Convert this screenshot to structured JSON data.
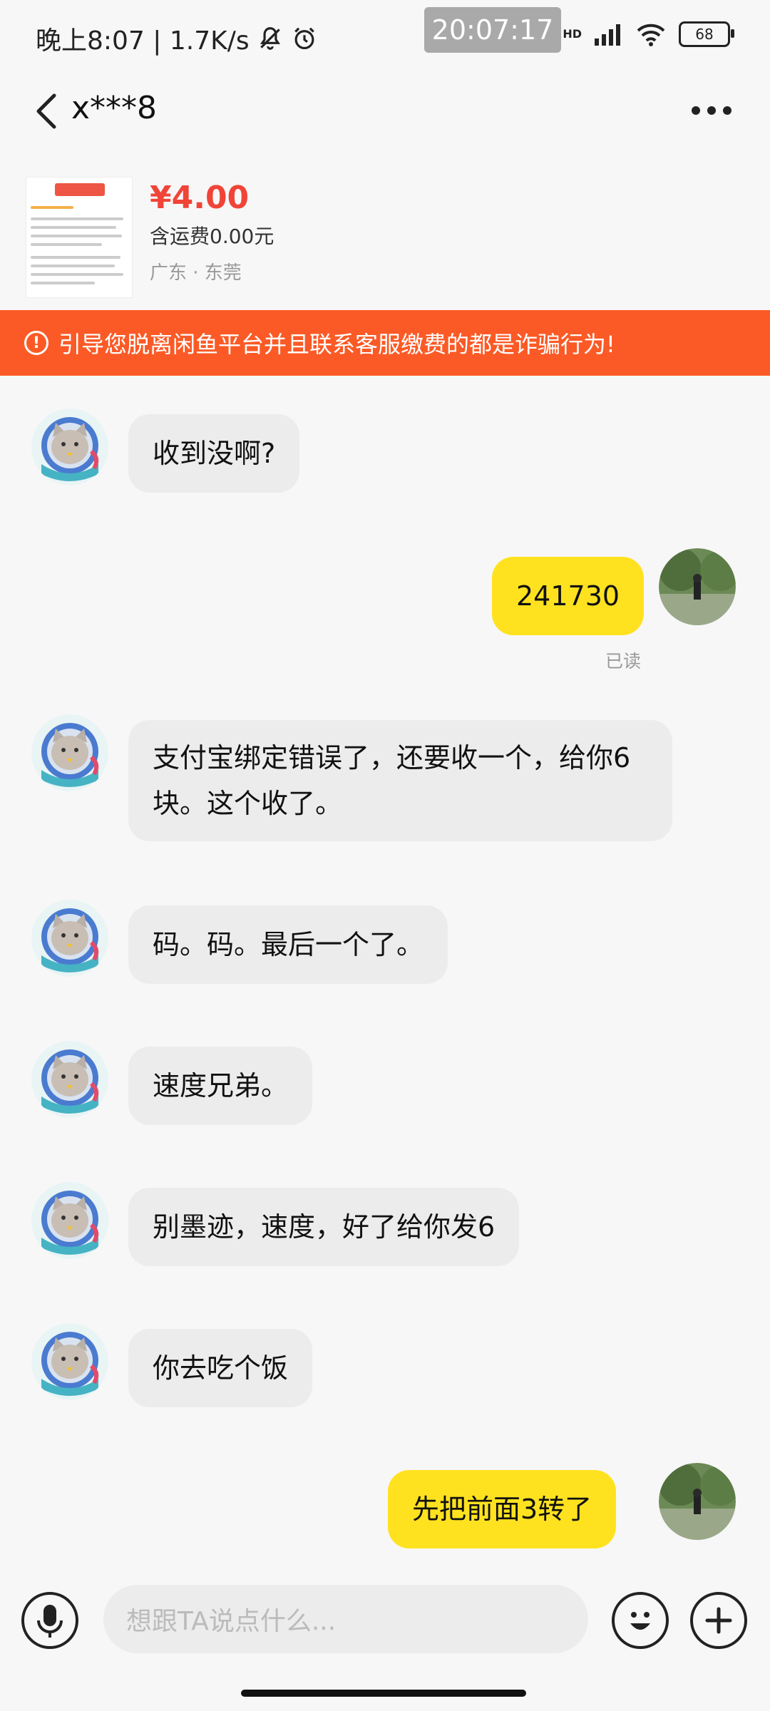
{
  "status_bar": {
    "time_label": "晚上8:07 | 1.7K/s",
    "clock_overlay": "20:07:17",
    "network_label": "HD",
    "battery": "68"
  },
  "header": {
    "title": "x***8"
  },
  "product": {
    "price": "¥4.00",
    "shipping": "含运费0.00元",
    "location": "广东 · 东莞"
  },
  "warning": {
    "icon": "!",
    "text": "引导您脱离闲鱼平台并且联系客服缴费的都是诈骗行为!"
  },
  "messages": [
    {
      "side": "left",
      "text": "收到没啊?"
    },
    {
      "side": "right",
      "text": "241730",
      "status": "已读"
    },
    {
      "side": "left",
      "text": "支付宝绑定错误了，还要收一个，给你6块。这个收了。"
    },
    {
      "side": "left",
      "text": "码。码。最后一个了。"
    },
    {
      "side": "left",
      "text": "速度兄弟。"
    },
    {
      "side": "left",
      "text": "别墨迹，速度，好了给你发6"
    },
    {
      "side": "left",
      "text": "你去吃个饭"
    },
    {
      "side": "right",
      "text": "先把前面3转了"
    }
  ],
  "input": {
    "placeholder": "想跟TA说点什么..."
  },
  "colors": {
    "warning_bg": "#fb5a26",
    "price": "#f04438",
    "own_bubble": "#ffe21f",
    "other_bubble": "#ececec"
  },
  "icons": [
    "back-icon",
    "more-icon",
    "mic-icon",
    "emoji-icon",
    "plus-icon",
    "bell-mute-icon",
    "alarm-icon",
    "signal-icon",
    "wifi-icon"
  ]
}
